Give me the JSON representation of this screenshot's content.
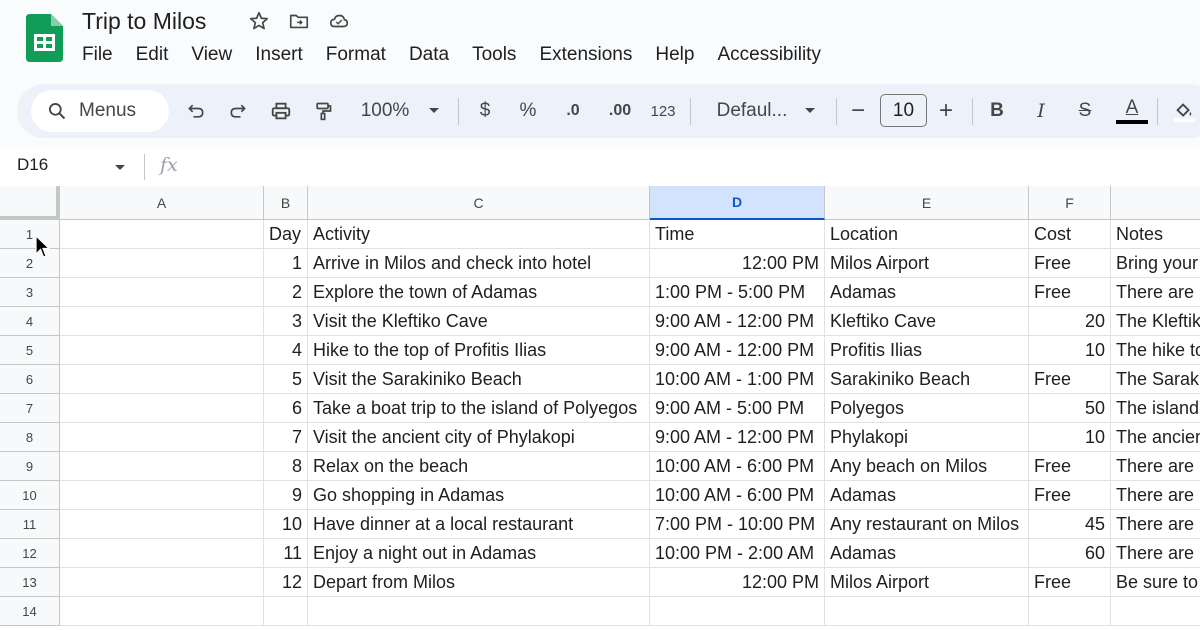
{
  "app": {
    "title": "Trip to Milos",
    "menu": [
      "File",
      "Edit",
      "View",
      "Insert",
      "Format",
      "Data",
      "Tools",
      "Extensions",
      "Help",
      "Accessibility"
    ]
  },
  "toolbar": {
    "search_label": "Menus",
    "zoom": "100%",
    "currency": "$",
    "percent": "%",
    "decrease_decimal": ".0",
    "increase_decimal": ".00",
    "number_format": "123",
    "font": "Defaul...",
    "font_size": "10",
    "minus": "−",
    "plus": "+",
    "bold": "B",
    "italic": "I",
    "strike": "S",
    "text_color": "A"
  },
  "formula_bar": {
    "cell_ref": "D16",
    "fx": "fx"
  },
  "columns": [
    "A",
    "B",
    "C",
    "D",
    "E",
    "F",
    ""
  ],
  "selected_column": "D",
  "rows": [
    {
      "n": "1",
      "b": "Day",
      "c": "Activity",
      "d": "Time",
      "e": "Location",
      "f": "Cost",
      "g": "Notes"
    },
    {
      "n": "2",
      "b": "1",
      "c": "Arrive in Milos and check into hotel",
      "d": "12:00 PM",
      "e": "Milos Airport",
      "f": "Free",
      "g": "Bring your"
    },
    {
      "n": "3",
      "b": "2",
      "c": "Explore the town of Adamas",
      "d": "1:00 PM - 5:00 PM",
      "e": "Adamas",
      "f": "Free",
      "g": "There are"
    },
    {
      "n": "4",
      "b": "3",
      "c": "Visit the Kleftiko Cave",
      "d": "9:00 AM - 12:00 PM",
      "e": "Kleftiko Cave",
      "f": "20",
      "g": "The Kleftik"
    },
    {
      "n": "5",
      "b": "4",
      "c": "Hike to the top of Profitis Ilias",
      "d": "9:00 AM - 12:00 PM",
      "e": "Profitis Ilias",
      "f": "10",
      "g": "The hike to"
    },
    {
      "n": "6",
      "b": "5",
      "c": "Visit the Sarakiniko Beach",
      "d": "10:00 AM - 1:00 PM",
      "e": "Sarakiniko Beach",
      "f": "Free",
      "g": "The Sarak"
    },
    {
      "n": "7",
      "b": "6",
      "c": "Take a boat trip to the island of Polyegos",
      "d": "9:00 AM - 5:00 PM",
      "e": "Polyegos",
      "f": "50",
      "g": "The island"
    },
    {
      "n": "8",
      "b": "7",
      "c": "Visit the ancient city of Phylakopi",
      "d": "9:00 AM - 12:00 PM",
      "e": "Phylakopi",
      "f": "10",
      "g": "The ancien"
    },
    {
      "n": "9",
      "b": "8",
      "c": "Relax on the beach",
      "d": "10:00 AM - 6:00 PM",
      "e": "Any beach on Milos",
      "f": "Free",
      "g": "There are"
    },
    {
      "n": "10",
      "b": "9",
      "c": "Go shopping in Adamas",
      "d": "10:00 AM - 6:00 PM",
      "e": "Adamas",
      "f": "Free",
      "g": "There are"
    },
    {
      "n": "11",
      "b": "10",
      "c": "Have dinner at a local restaurant",
      "d": "7:00 PM - 10:00 PM",
      "e": "Any restaurant on Milos",
      "f": "45",
      "g": "There are"
    },
    {
      "n": "12",
      "b": "11",
      "c": "Enjoy a night out in Adamas",
      "d": "10:00 PM - 2:00 AM",
      "e": "Adamas",
      "f": "60",
      "g": "There are"
    },
    {
      "n": "13",
      "b": "12",
      "c": "Depart from Milos",
      "d": "12:00 PM",
      "e": "Milos Airport",
      "f": "Free",
      "g": "Be sure to"
    },
    {
      "n": "14",
      "b": "",
      "c": "",
      "d": "",
      "e": "",
      "f": "",
      "g": ""
    }
  ],
  "colors": {
    "accent": "#0b57d0",
    "selected_header": "#d3e3fd",
    "toolbar_bg": "#edf2fa",
    "sheets_green": "#0f9d58"
  }
}
